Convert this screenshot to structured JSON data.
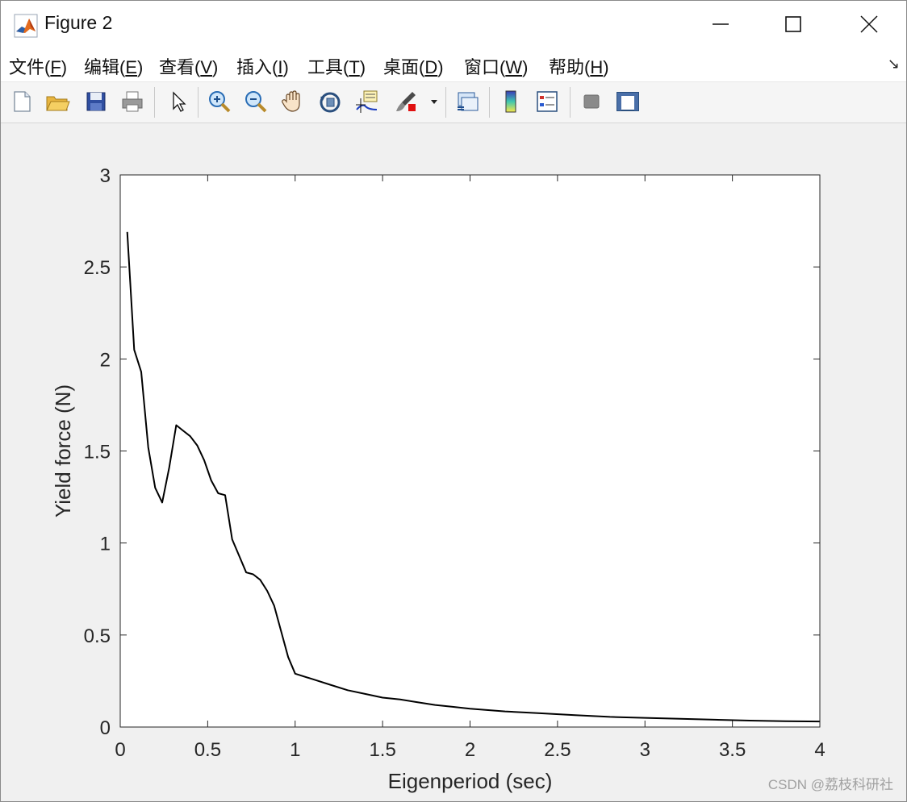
{
  "window": {
    "title": "Figure 2"
  },
  "menu": [
    {
      "label": "文件(",
      "key": "F",
      "end": ")"
    },
    {
      "label": "编辑(",
      "key": "E",
      "end": ")"
    },
    {
      "label": "查看(",
      "key": "V",
      "end": ")"
    },
    {
      "label": "插入(",
      "key": "I",
      "end": ")"
    },
    {
      "label": "工具(",
      "key": "T",
      "end": ")"
    },
    {
      "label": "桌面(",
      "key": "D",
      "end": ")"
    },
    {
      "label": "窗口(",
      "key": "W",
      "end": ")"
    },
    {
      "label": "帮助(",
      "key": "H",
      "end": ")"
    }
  ],
  "toolbar_icons": [
    "new-file-icon",
    "open-folder-icon",
    "save-icon",
    "print-icon",
    "pointer-icon",
    "zoom-in-icon",
    "zoom-out-icon",
    "pan-hand-icon",
    "rotate-3d-icon",
    "data-cursor-icon",
    "brush-icon",
    "link-plot-icon",
    "colorbar-icon",
    "legend-icon",
    "hide-plot-tools-icon",
    "show-plot-tools-icon"
  ],
  "colors": {
    "line": "#000000",
    "axes_bg": "#ffffff",
    "figure_bg": "#f0f0f0",
    "titlebar": "#ffffff"
  },
  "watermark": "CSDN @荔枝科研社",
  "chart_data": {
    "type": "line",
    "title": "",
    "xlabel": "Eigenperiod (sec)",
    "ylabel": "Yield force (N)",
    "xlim": [
      0,
      4
    ],
    "ylim": [
      0,
      3
    ],
    "xticks": [
      "0",
      "0.5",
      "1",
      "1.5",
      "2",
      "2.5",
      "3",
      "3.5",
      "4"
    ],
    "yticks": [
      "0",
      "0.5",
      "1",
      "1.5",
      "2",
      "2.5",
      "3"
    ],
    "grid": false,
    "series": [
      {
        "x": [
          0.04,
          0.08,
          0.12,
          0.16,
          0.2,
          0.24,
          0.28,
          0.32,
          0.36,
          0.4,
          0.44,
          0.48,
          0.52,
          0.56,
          0.6,
          0.64,
          0.68,
          0.72,
          0.76,
          0.8,
          0.84,
          0.88,
          0.92,
          0.96,
          1.0,
          1.1,
          1.2,
          1.3,
          1.4,
          1.5,
          1.6,
          1.7,
          1.8,
          1.9,
          2.0,
          2.2,
          2.4,
          2.6,
          2.8,
          3.0,
          3.2,
          3.4,
          3.6,
          3.8,
          4.0
        ],
        "y": [
          2.69,
          2.05,
          1.93,
          1.52,
          1.3,
          1.22,
          1.41,
          1.64,
          1.61,
          1.58,
          1.53,
          1.45,
          1.34,
          1.27,
          1.26,
          1.02,
          0.93,
          0.84,
          0.83,
          0.8,
          0.74,
          0.66,
          0.52,
          0.38,
          0.29,
          0.26,
          0.23,
          0.2,
          0.18,
          0.16,
          0.15,
          0.135,
          0.12,
          0.11,
          0.1,
          0.085,
          0.075,
          0.065,
          0.055,
          0.05,
          0.045,
          0.04,
          0.035,
          0.032,
          0.03
        ]
      }
    ]
  }
}
